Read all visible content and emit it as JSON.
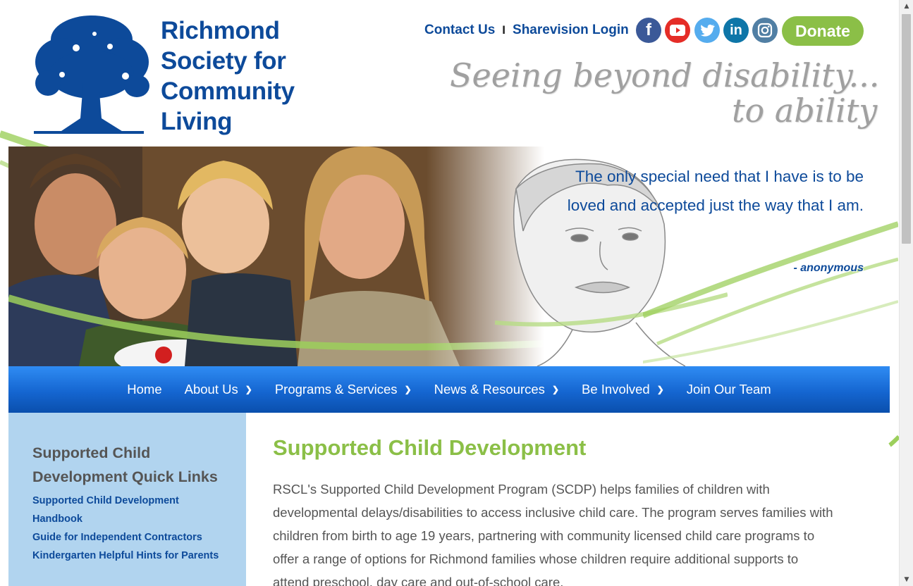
{
  "header": {
    "logo_lines": [
      "Richmond",
      "Society for",
      "Community",
      "Living"
    ],
    "top_links": [
      "Contact Us",
      "Sharevision Login"
    ],
    "separator": "I",
    "social_icons": [
      "facebook-icon",
      "youtube-icon",
      "twitter-icon",
      "linkedin-icon",
      "instagram-icon"
    ],
    "donate_label": "Donate",
    "tagline_line1": "Seeing beyond disability...",
    "tagline_line2": "to ability"
  },
  "hero": {
    "quote": "The only special need that I have is to be loved and accepted just the way that I am.",
    "author": "- anonymous"
  },
  "nav": {
    "items": [
      {
        "label": "Home",
        "has_dropdown": false
      },
      {
        "label": "About Us",
        "has_dropdown": true
      },
      {
        "label": "Programs & Services",
        "has_dropdown": true
      },
      {
        "label": "News & Resources",
        "has_dropdown": true
      },
      {
        "label": "Be Involved",
        "has_dropdown": true
      },
      {
        "label": "Join Our Team",
        "has_dropdown": false
      }
    ]
  },
  "sidebar": {
    "title": "Supported Child Development Quick Links",
    "links": [
      "Supported Child Development Handbook",
      "Guide for Independent Contractors",
      "Kindergarten Helpful Hints for Parents"
    ]
  },
  "main": {
    "title": "Supported Child Development",
    "intro": "RSCL's Supported Child Development Program (SCDP) helps families of children with developmental delays/disabilities to access inclusive child care. The program serves families with children from birth to age 19 years, partnering with community licensed child care programs to offer a range of options for Richmond families whose children require additional supports to attend preschool, day care and out-of-school care."
  },
  "colors": {
    "brand_blue": "#0d4a9a",
    "accent_green": "#8bbf47",
    "nav_blue": "#1566d1",
    "sidebar_bg": "#b1d4ef"
  }
}
